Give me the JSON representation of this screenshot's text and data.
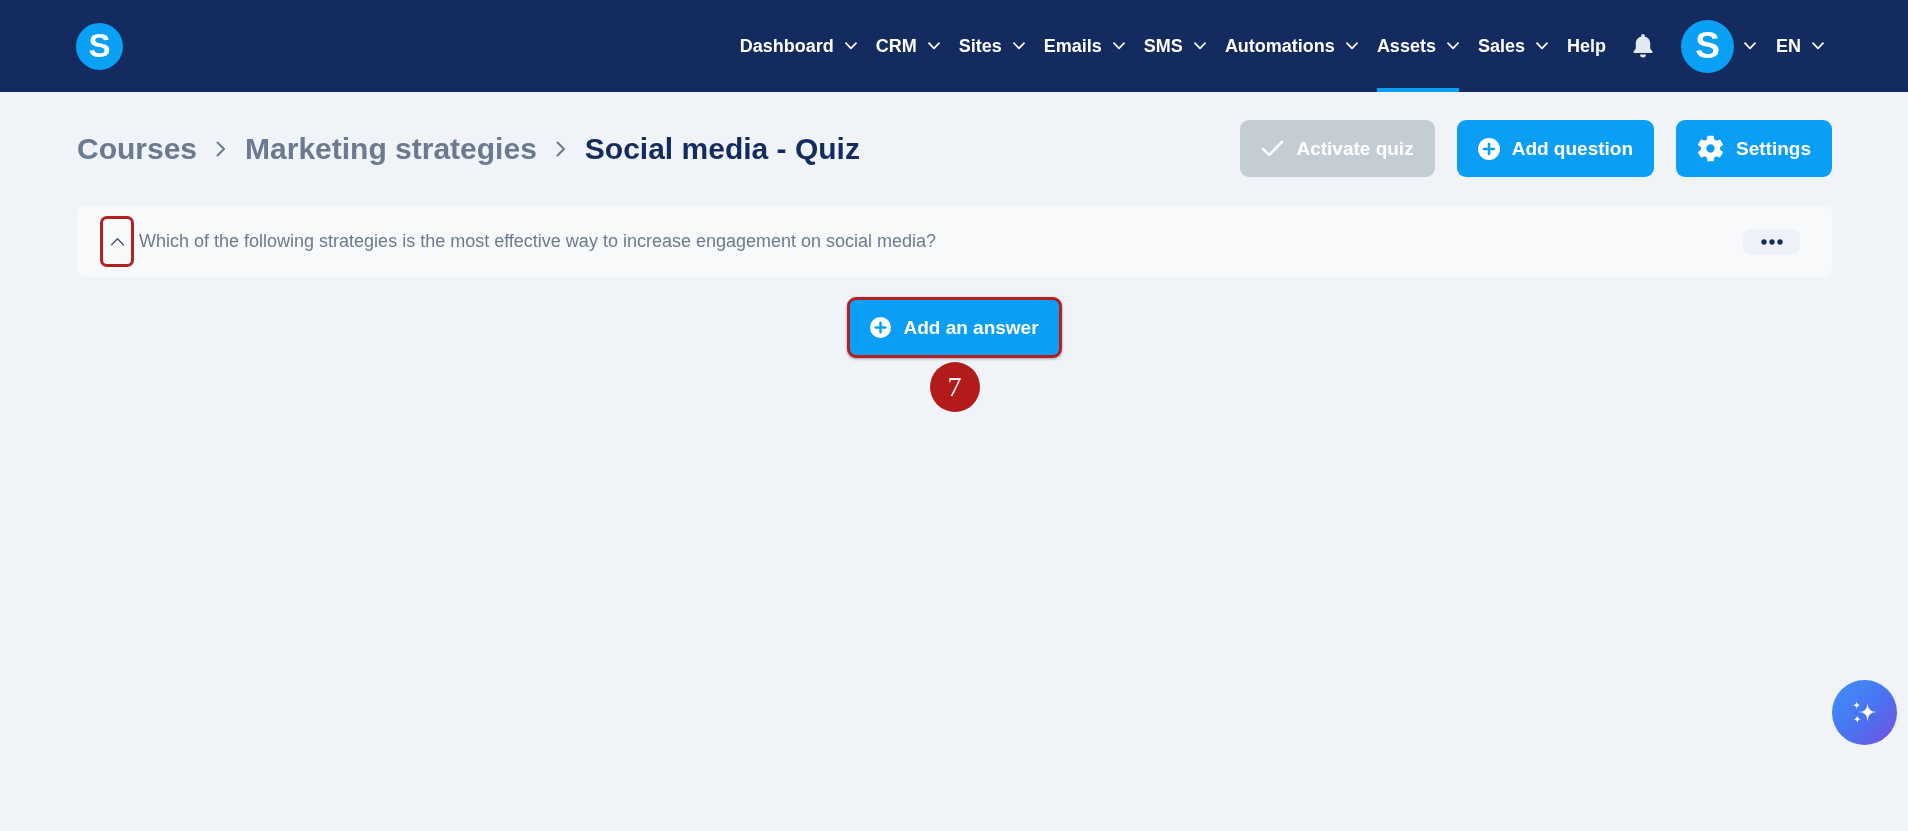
{
  "header": {
    "logo": {
      "letter": "S"
    },
    "nav": [
      {
        "label": "Dashboard",
        "dropdown": true,
        "selected": false
      },
      {
        "label": "CRM",
        "dropdown": true,
        "selected": false
      },
      {
        "label": "Sites",
        "dropdown": true,
        "selected": false
      },
      {
        "label": "Emails",
        "dropdown": true,
        "selected": false
      },
      {
        "label": "SMS",
        "dropdown": true,
        "selected": false
      },
      {
        "label": "Automations",
        "dropdown": true,
        "selected": false
      },
      {
        "label": "Assets",
        "dropdown": true,
        "selected": true
      },
      {
        "label": "Sales",
        "dropdown": true,
        "selected": false
      },
      {
        "label": "Help",
        "dropdown": false,
        "selected": false
      }
    ],
    "avatar": {
      "letter": "S"
    },
    "language": {
      "label": "EN"
    }
  },
  "breadcrumb": [
    {
      "label": "Courses",
      "current": false
    },
    {
      "label": "Marketing strategies",
      "current": false
    },
    {
      "label": "Social media - Quiz",
      "current": true
    }
  ],
  "actions": [
    {
      "kind": "activate",
      "label": "Activate quiz",
      "disabled": true
    },
    {
      "kind": "add",
      "label": "Add question",
      "disabled": false
    },
    {
      "kind": "settings",
      "label": "Settings",
      "disabled": false
    }
  ],
  "question": {
    "text": "Which of the following strategies is the most effective way to increase engagement on social media?",
    "expanded": true,
    "toggle_highlighted": true
  },
  "add_answer": {
    "label": "Add an answer",
    "highlighted": true
  },
  "step_badge": {
    "number": "7"
  }
}
